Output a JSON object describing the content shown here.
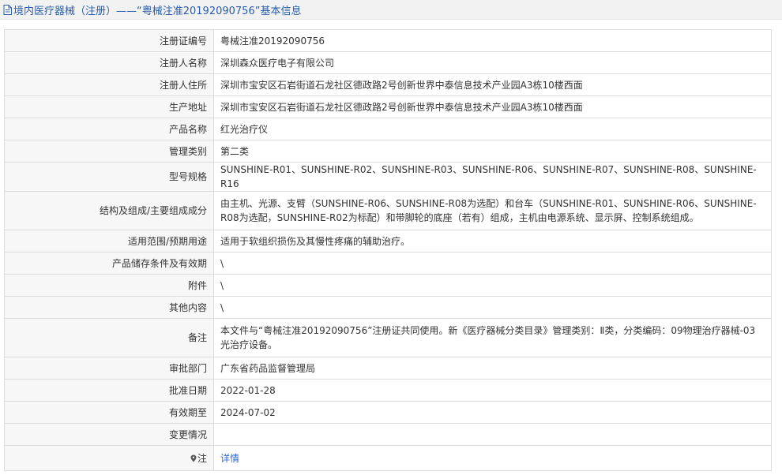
{
  "header": {
    "title": "境内医疗器械（注册）——“粤械注准20192090756”基本信息"
  },
  "rows": [
    {
      "label": "注册证编号",
      "value": "粤械注准20192090756"
    },
    {
      "label": "注册人名称",
      "value": "深圳森众医疗电子有限公司"
    },
    {
      "label": "注册人住所",
      "value": "深圳市宝安区石岩街道石龙社区德政路2号创新世界中泰信息技术产业园A3栋10楼西面"
    },
    {
      "label": "生产地址",
      "value": "深圳市宝安区石岩街道石龙社区德政路2号创新世界中泰信息技术产业园A3栋10楼西面"
    },
    {
      "label": "产品名称",
      "value": "红光治疗仪"
    },
    {
      "label": "管理类别",
      "value": "第二类"
    },
    {
      "label": "型号规格",
      "value": "SUNSHINE-R01、SUNSHINE-R02、SUNSHINE-R03、SUNSHINE-R06、SUNSHINE-R07、SUNSHINE-R08、SUNSHINE-R16"
    },
    {
      "label": "结构及组成/主要组成成分",
      "value": "由主机、光源、支臂（SUNSHINE-R06、SUNSHINE-R08为选配）和台车（SUNSHINE-R01、SUNSHINE-R06、SUNSHINE-R08为选配，SUNSHINE-R02为标配）和带脚轮的底座（若有）组成，主机由电源系统、显示屏、控制系统组成。"
    },
    {
      "label": "适用范围/预期用途",
      "value": "适用于软组织损伤及其慢性疼痛的辅助治疗。"
    },
    {
      "label": "产品储存条件及有效期",
      "value": "\\"
    },
    {
      "label": "附件",
      "value": "\\"
    },
    {
      "label": "其他内容",
      "value": "\\"
    },
    {
      "label": "备注",
      "value": "本文件与“粤械注准20192090756”注册证共同使用。新《医疗器械分类目录》管理类别：Ⅱ类，分类编码：09物理治疗器械-03光治疗设备。"
    },
    {
      "label": "审批部门",
      "value": "广东省药品监督管理局"
    },
    {
      "label": "批准日期",
      "value": "2022-01-28"
    },
    {
      "label": "有效期至",
      "value": "2024-07-02"
    },
    {
      "label": "变更情况",
      "value": ""
    }
  ],
  "note": {
    "label": "注",
    "link_text": "详情"
  },
  "colors": {
    "title": "#2a5caa",
    "link": "#2a6cc9",
    "label_bg": "#f7f7f7",
    "border": "#dcdcdc"
  }
}
